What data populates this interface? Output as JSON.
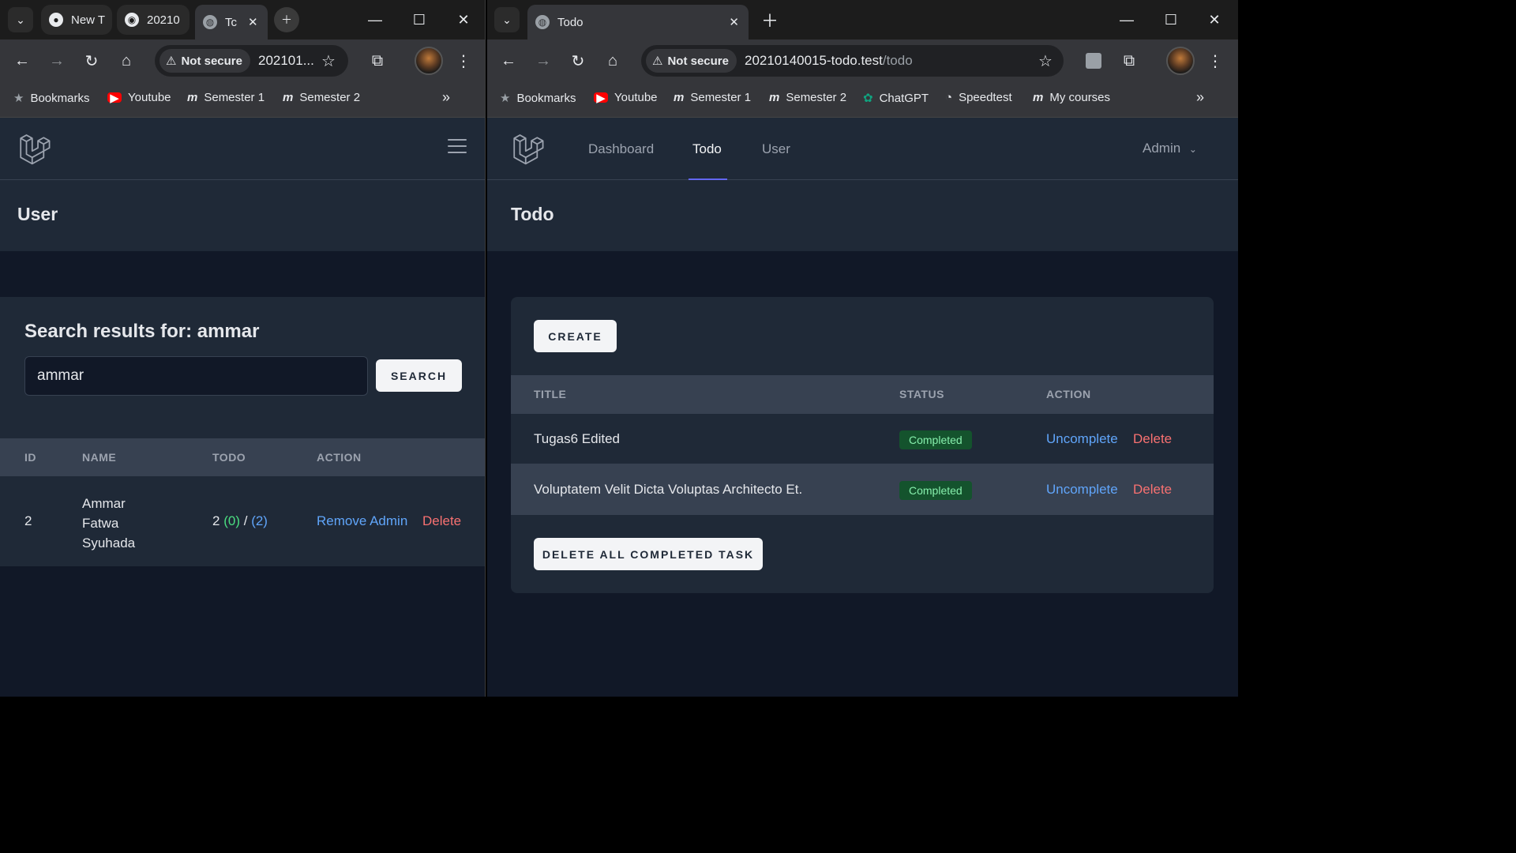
{
  "left_window": {
    "tabs": [
      {
        "label": "New T",
        "icon": "chrome-icon"
      },
      {
        "label": "20210",
        "icon": "github-icon"
      },
      {
        "label": "Tc",
        "icon": "globe-icon"
      }
    ],
    "omnibox": {
      "security": "Not secure",
      "url": "202101..."
    },
    "bookmarks": [
      {
        "label": "Bookmarks",
        "icon": "star-icon"
      },
      {
        "label": "Youtube",
        "icon": "youtube-icon"
      },
      {
        "label": "Semester 1",
        "icon": "moodle-icon"
      },
      {
        "label": "Semester 2",
        "icon": "moodle-icon"
      }
    ],
    "page": {
      "header": "User",
      "search_heading": "Search results for: ammar",
      "search_value": "ammar",
      "search_button": "SEARCH",
      "table": {
        "headers": [
          "ID",
          "NAME",
          "TODO",
          "ACTION"
        ],
        "rows": [
          {
            "id": "2",
            "name_lines": [
              "Ammar",
              "Fatwa",
              "Syuhada"
            ],
            "todo_total": "2",
            "todo_done": "(0)",
            "todo_sep": "/",
            "todo_open": "(2)",
            "action_primary": "Remove Admin",
            "action_delete": "Delete"
          }
        ]
      }
    }
  },
  "right_window": {
    "tab": {
      "label": "Todo",
      "icon": "globe-icon"
    },
    "omnibox": {
      "security": "Not secure",
      "host": "20210140015-todo.test",
      "path": "/todo"
    },
    "bookmarks": [
      {
        "label": "Bookmarks",
        "icon": "star-icon"
      },
      {
        "label": "Youtube",
        "icon": "youtube-icon"
      },
      {
        "label": "Semester 1",
        "icon": "moodle-icon"
      },
      {
        "label": "Semester 2",
        "icon": "moodle-icon"
      },
      {
        "label": "ChatGPT",
        "icon": "chatgpt-icon"
      },
      {
        "label": "Speedtest",
        "icon": "speedtest-icon"
      },
      {
        "label": "My courses",
        "icon": "moodle-icon"
      }
    ],
    "nav": {
      "links": [
        "Dashboard",
        "Todo",
        "User"
      ],
      "active": "Todo",
      "user_menu": "Admin"
    },
    "page": {
      "header": "Todo",
      "create_button": "CREATE",
      "table": {
        "headers": [
          "TITLE",
          "STATUS",
          "ACTION"
        ],
        "rows": [
          {
            "title": "Tugas6 Edited",
            "status": "Completed",
            "action_toggle": "Uncomplete",
            "action_delete": "Delete"
          },
          {
            "title": "Voluptatem Velit Dicta Voluptas Architecto Et.",
            "status": "Completed",
            "action_toggle": "Uncomplete",
            "action_delete": "Delete"
          }
        ]
      },
      "delete_all_button": "DELETE ALL COMPLETED TASK"
    }
  },
  "colors": {
    "page_bg": "#111827",
    "panel_bg": "#1f2937",
    "accent": "#6366f1",
    "link_blue": "#60a5fa",
    "link_red": "#f87171",
    "badge_green": "#14532d"
  }
}
